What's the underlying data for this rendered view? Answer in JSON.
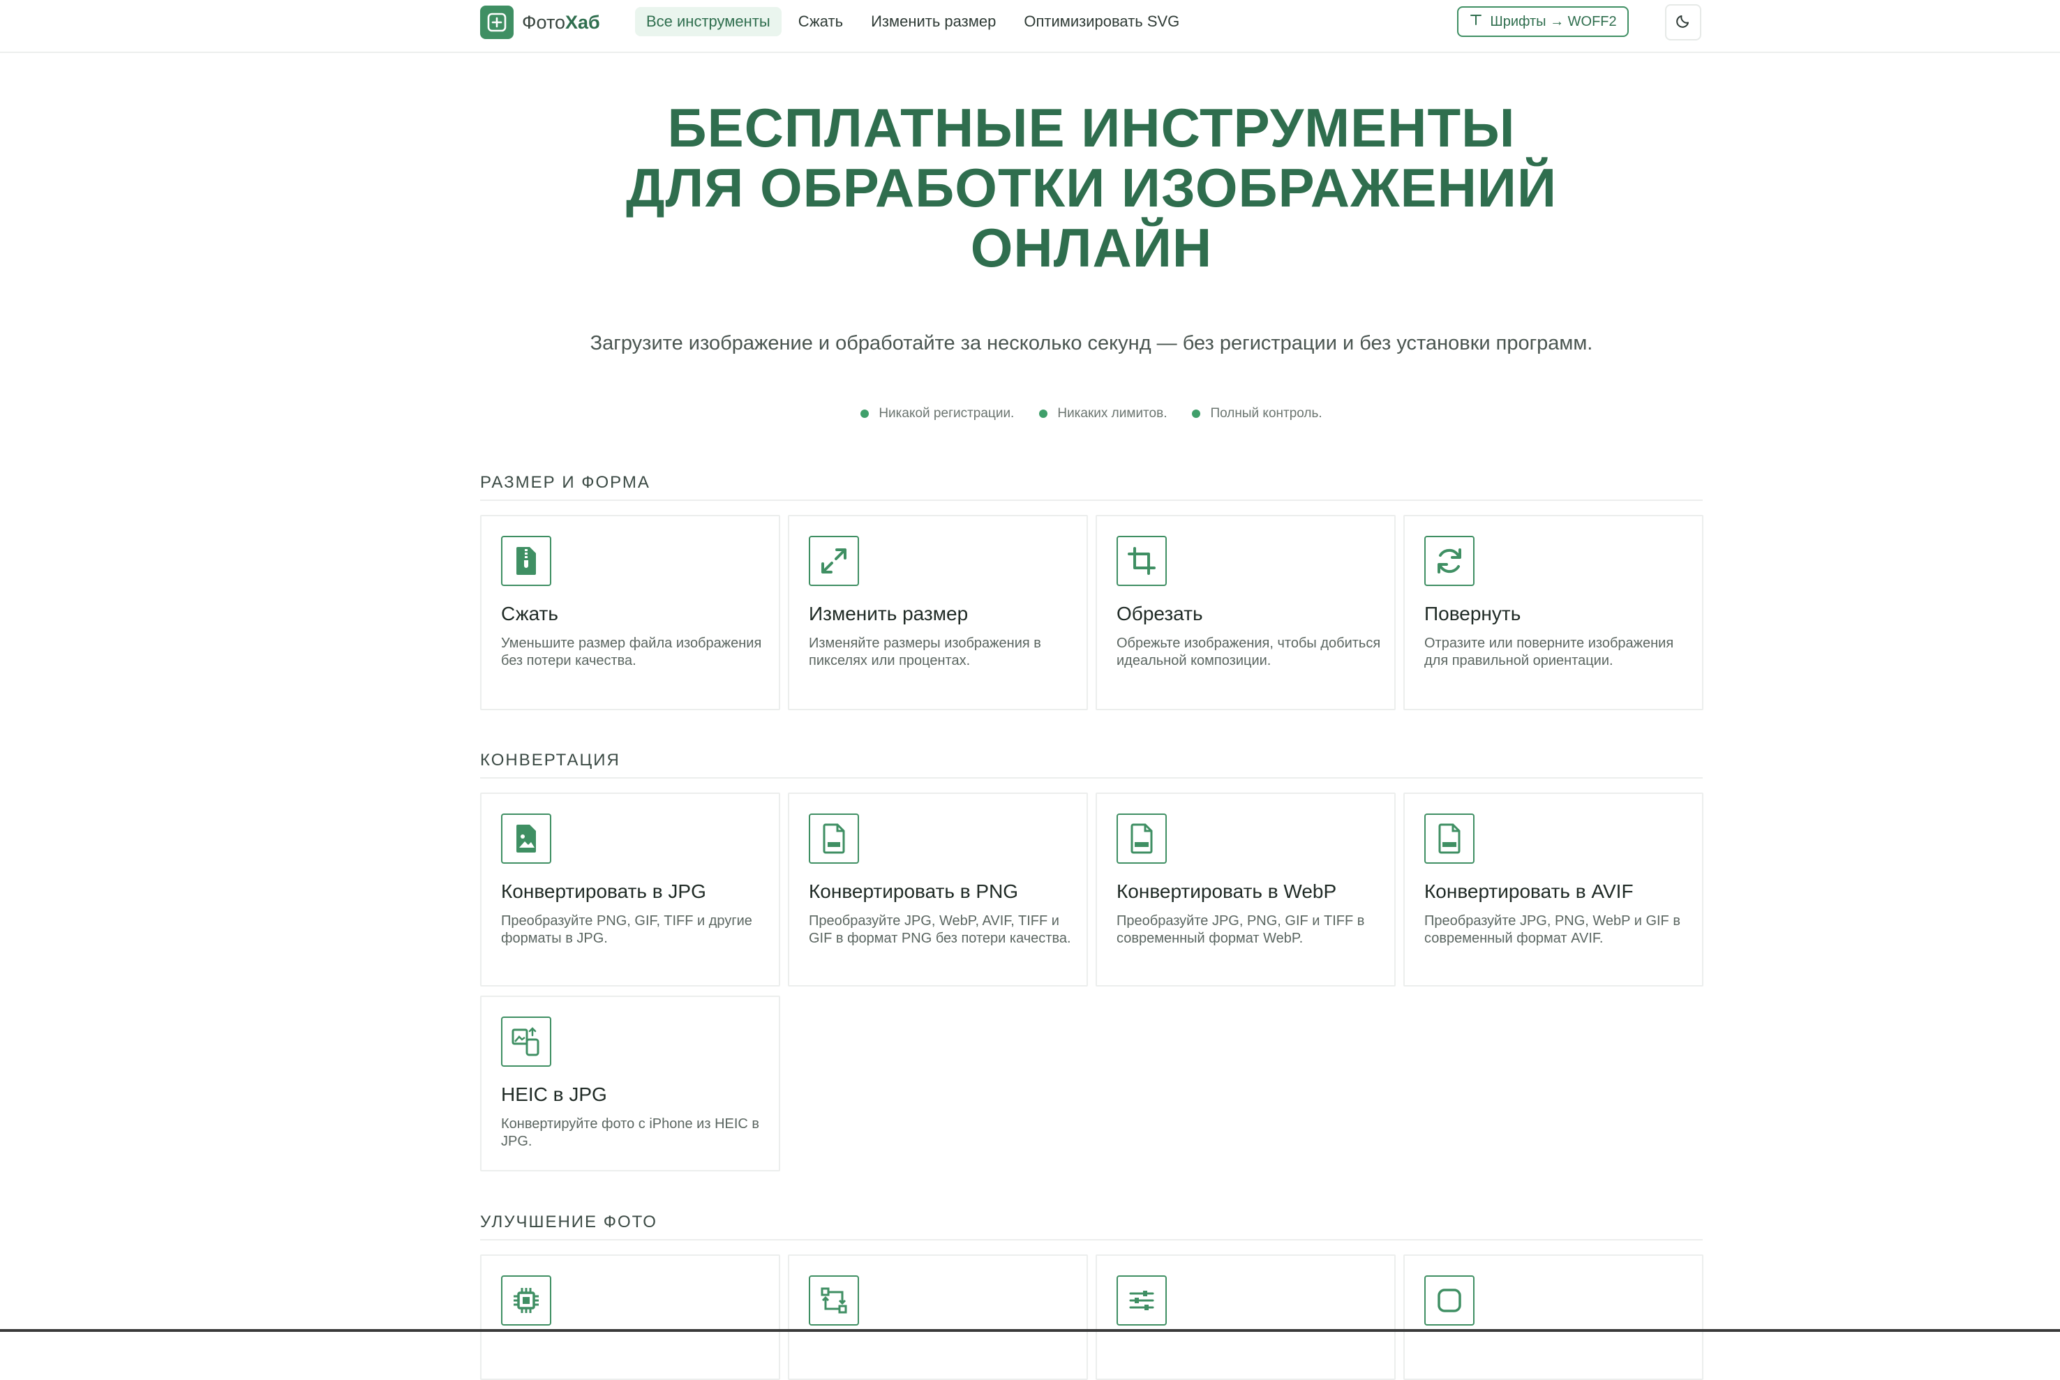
{
  "header": {
    "logo": {
      "prefix": "Фото",
      "suffix": "Хаб"
    },
    "nav": [
      {
        "label": "Все инструменты",
        "active": true
      },
      {
        "label": "Сжать",
        "active": false
      },
      {
        "label": "Изменить размер",
        "active": false
      },
      {
        "label": "Оптимизировать SVG",
        "active": false
      }
    ],
    "fonts_button": "Шрифты → WOFF2",
    "theme_icon": "moon-icon"
  },
  "hero": {
    "title_lines": [
      "БЕСПЛАТНЫЕ ИНСТРУМЕНТЫ",
      "ДЛЯ ОБРАБОТКИ ИЗОБРАЖЕНИЙ",
      "ОНЛАЙН"
    ],
    "subtitle": "Загрузите изображение и обработайте за несколько секунд — без регистрации и без установки программ.",
    "badges": [
      "Никакой регистрации.",
      "Никаких лимитов.",
      "Полный контроль."
    ]
  },
  "sections": [
    {
      "title": "РАЗМЕР И ФОРМА",
      "cards": [
        {
          "icon": "zip-file-icon",
          "title": "Сжать",
          "desc": "Уменьшите размер файла изображения без потери качества."
        },
        {
          "icon": "expand-icon",
          "title": "Изменить размер",
          "desc": "Изменяйте размеры изображения в пикселях или процентах."
        },
        {
          "icon": "crop-icon",
          "title": "Обрезать",
          "desc": "Обрежьте изображения, чтобы добиться идеальной композиции."
        },
        {
          "icon": "rotate-icon",
          "title": "Повернуть",
          "desc": "Отразите или поверните изображения для правильной ориентации."
        }
      ]
    },
    {
      "title": "КОНВЕРТАЦИЯ",
      "cards": [
        {
          "icon": "image-file-icon",
          "title": "Конвертировать в JPG",
          "desc": "Преобразуйте PNG, GIF, TIFF и другие форматы в JPG."
        },
        {
          "icon": "png-file-icon",
          "title": "Конвертировать в PNG",
          "desc": "Преобразуйте JPG, WebP, AVIF, TIFF и GIF в формат PNG без потери качества."
        },
        {
          "icon": "webp-file-icon",
          "title": "Конвертировать в WebP",
          "desc": "Преобразуйте JPG, PNG, GIF и TIFF в современный формат WebP."
        },
        {
          "icon": "avif-file-icon",
          "title": "Конвертировать в AVIF",
          "desc": "Преобразуйте JPG, PNG, WebP и GIF в современный формат AVIF."
        },
        {
          "icon": "heic-convert-icon",
          "title": "HEIC в JPG",
          "desc": "Конвертируйте фото с iPhone из HEIC в JPG."
        }
      ]
    },
    {
      "title": "УЛУЧШЕНИЕ ФОТО",
      "cards": [
        {
          "icon": "chip-icon",
          "title": "",
          "desc": ""
        },
        {
          "icon": "transform-icon",
          "title": "",
          "desc": ""
        },
        {
          "icon": "sliders-icon",
          "title": "",
          "desc": ""
        },
        {
          "icon": "rounded-square-icon",
          "title": "",
          "desc": ""
        }
      ]
    }
  ],
  "colors": {
    "accent": "#3f8f63",
    "heading": "#2f6e4e",
    "nav_active_bg": "#eaf5ee"
  }
}
